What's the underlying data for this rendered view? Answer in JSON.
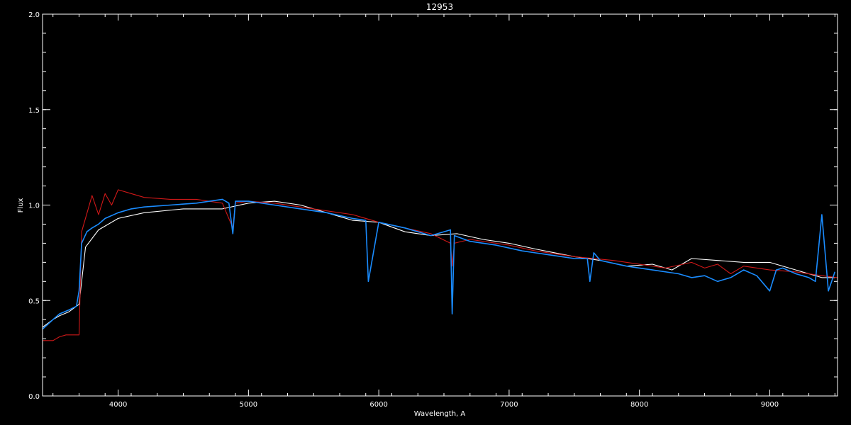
{
  "chart_data": {
    "type": "line",
    "title": "12953",
    "xlabel": "Wavelength, A",
    "ylabel": "Flux",
    "xlim": [
      3420,
      9520
    ],
    "ylim": [
      0.0,
      2.0
    ],
    "x_ticks": [
      {
        "value": 4000,
        "label": "4000"
      },
      {
        "value": 5000,
        "label": "5000"
      },
      {
        "value": 6000,
        "label": "6000"
      },
      {
        "value": 7000,
        "label": "7000"
      },
      {
        "value": 8000,
        "label": "8000"
      },
      {
        "value": 9000,
        "label": "9000"
      }
    ],
    "y_ticks": [
      {
        "value": 0.0,
        "label": "0.0"
      },
      {
        "value": 0.5,
        "label": "0.5"
      },
      {
        "value": 1.0,
        "label": "1.0"
      },
      {
        "value": 1.5,
        "label": "1.5"
      },
      {
        "value": 2.0,
        "label": "2.0"
      }
    ],
    "background": "#000000",
    "axis_color": "#ffffff",
    "series": [
      {
        "color": "#ffffff",
        "x": [
          3420,
          3500,
          3550,
          3620,
          3700,
          3750,
          3850,
          4000,
          4200,
          4500,
          4800,
          5000,
          5200,
          5400,
          5600,
          5800,
          6000,
          6200,
          6400,
          6600,
          6800,
          7000,
          7200,
          7500,
          7700,
          7900,
          8100,
          8250,
          8400,
          8600,
          8800,
          9000,
          9200,
          9400,
          9500
        ],
        "y": [
          0.36,
          0.4,
          0.42,
          0.44,
          0.48,
          0.78,
          0.87,
          0.93,
          0.96,
          0.98,
          0.98,
          1.01,
          1.02,
          1.0,
          0.96,
          0.92,
          0.91,
          0.86,
          0.84,
          0.85,
          0.82,
          0.8,
          0.77,
          0.73,
          0.71,
          0.68,
          0.69,
          0.66,
          0.72,
          0.71,
          0.7,
          0.7,
          0.66,
          0.62,
          0.62
        ]
      },
      {
        "color": "#d01818",
        "x": [
          3420,
          3500,
          3550,
          3600,
          3700,
          3720,
          3800,
          3850,
          3900,
          3950,
          4000,
          4100,
          4200,
          4400,
          4600,
          4800,
          4880,
          4900,
          5000,
          5200,
          5500,
          5800,
          6000,
          6200,
          6400,
          6550,
          6563,
          6580,
          6700,
          7000,
          7200,
          7500,
          7800,
          8000,
          8200,
          8400,
          8500,
          8600,
          8700,
          8800,
          9000,
          9200,
          9400,
          9520
        ],
        "y": [
          0.29,
          0.29,
          0.31,
          0.32,
          0.32,
          0.86,
          1.05,
          0.95,
          1.06,
          1.0,
          1.08,
          1.06,
          1.04,
          1.03,
          1.03,
          1.01,
          0.88,
          1.01,
          1.02,
          1.01,
          0.98,
          0.95,
          0.91,
          0.88,
          0.85,
          0.8,
          0.68,
          0.8,
          0.82,
          0.79,
          0.76,
          0.73,
          0.71,
          0.69,
          0.67,
          0.7,
          0.67,
          0.69,
          0.64,
          0.68,
          0.66,
          0.65,
          0.63,
          0.62
        ]
      },
      {
        "color": "#1a8cff",
        "x": [
          3420,
          3500,
          3550,
          3620,
          3680,
          3700,
          3720,
          3760,
          3800,
          3850,
          3900,
          4000,
          4100,
          4200,
          4400,
          4600,
          4800,
          4850,
          4880,
          4900,
          5000,
          5200,
          5400,
          5600,
          5800,
          5900,
          5920,
          6000,
          6200,
          6400,
          6550,
          6563,
          6580,
          6700,
          6900,
          7100,
          7300,
          7500,
          7600,
          7620,
          7650,
          7700,
          7900,
          8000,
          8100,
          8300,
          8400,
          8500,
          8600,
          8700,
          8800,
          8900,
          9000,
          9050,
          9100,
          9200,
          9300,
          9350,
          9400,
          9450,
          9500
        ],
        "y": [
          0.35,
          0.4,
          0.43,
          0.45,
          0.47,
          0.55,
          0.8,
          0.86,
          0.88,
          0.9,
          0.93,
          0.96,
          0.98,
          0.99,
          1.0,
          1.01,
          1.03,
          1.01,
          0.85,
          1.02,
          1.02,
          1.0,
          0.98,
          0.96,
          0.93,
          0.92,
          0.6,
          0.91,
          0.88,
          0.84,
          0.87,
          0.43,
          0.84,
          0.81,
          0.79,
          0.76,
          0.74,
          0.72,
          0.72,
          0.6,
          0.75,
          0.71,
          0.68,
          0.67,
          0.66,
          0.64,
          0.62,
          0.63,
          0.6,
          0.62,
          0.66,
          0.63,
          0.55,
          0.66,
          0.67,
          0.64,
          0.62,
          0.6,
          0.95,
          0.55,
          0.65
        ]
      }
    ]
  }
}
